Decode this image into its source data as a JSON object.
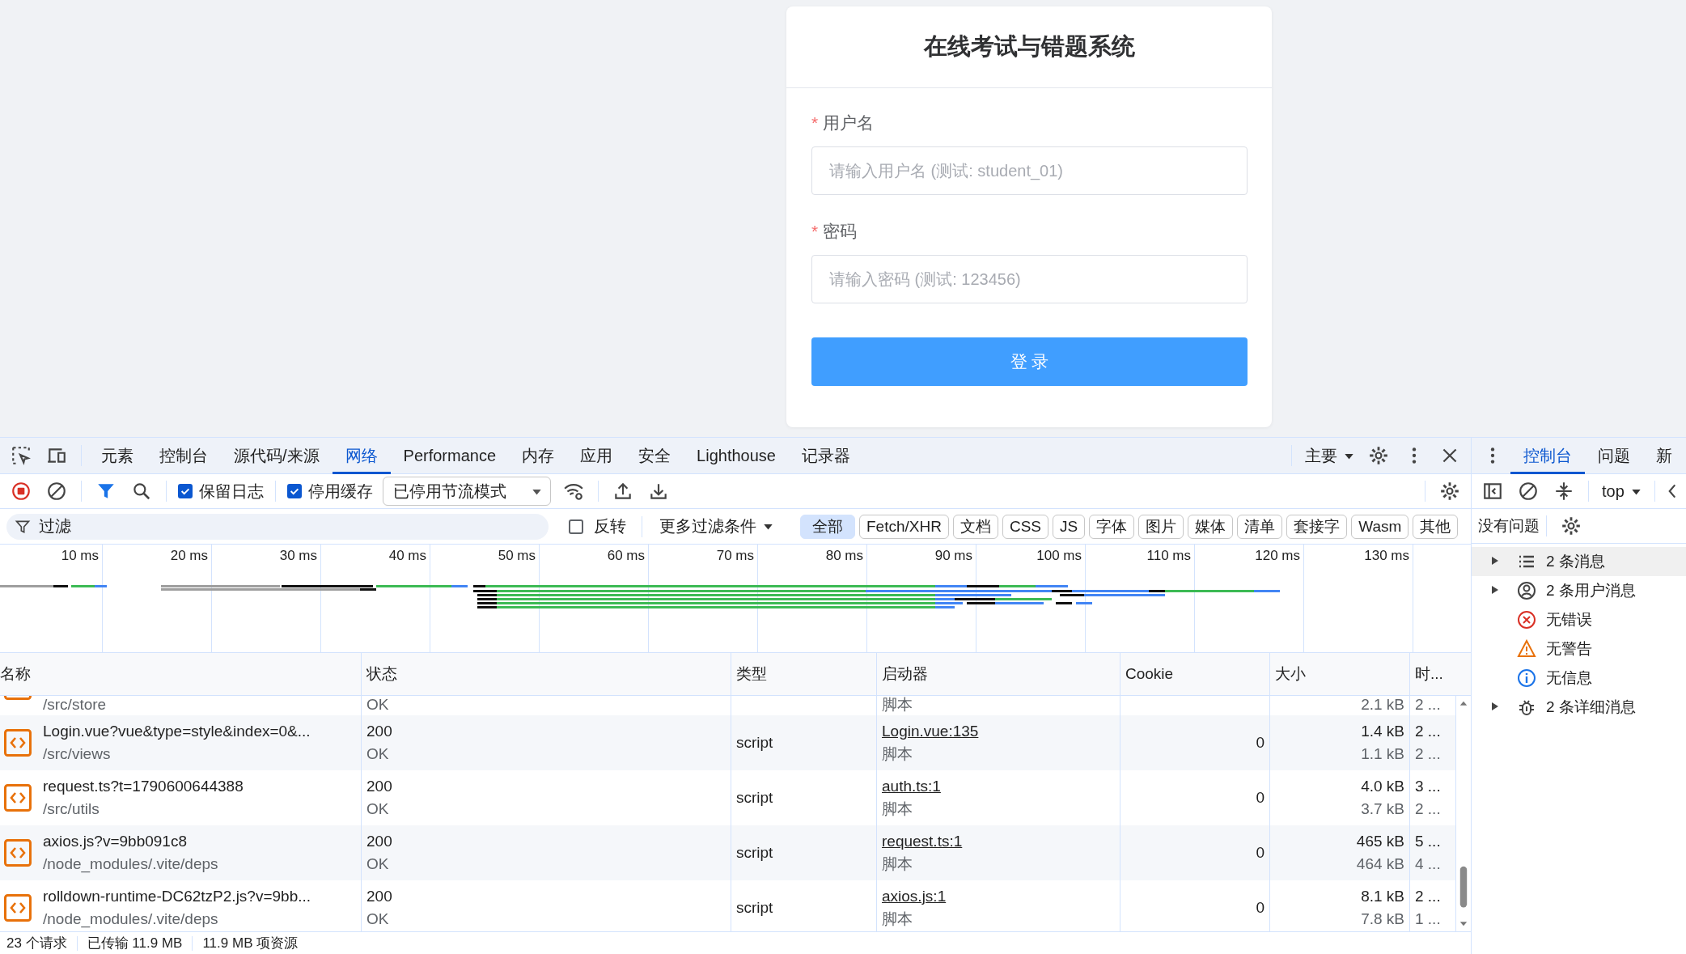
{
  "login": {
    "title": "在线考试与错题系统",
    "fields": [
      {
        "required_mark": "*",
        "label": "用户名",
        "placeholder": "请输入用户名 (测试: student_01)"
      },
      {
        "required_mark": "*",
        "label": "密码",
        "placeholder": "请输入密码 (测试: 123456)"
      }
    ],
    "button": "登 录"
  },
  "devtools": {
    "tabs": [
      {
        "label": "元素",
        "selected": false
      },
      {
        "label": "控制台",
        "selected": false
      },
      {
        "label": "源代码/来源",
        "selected": false
      },
      {
        "label": "网络",
        "selected": true
      },
      {
        "label": "Performance",
        "selected": false
      },
      {
        "label": "内存",
        "selected": false
      },
      {
        "label": "应用",
        "selected": false
      },
      {
        "label": "安全",
        "selected": false
      },
      {
        "label": "Lighthouse",
        "selected": false
      },
      {
        "label": "记录器",
        "selected": false
      }
    ],
    "panel_menu": "主要",
    "toolbar": {
      "recording": true,
      "filter_active": true,
      "checkboxes": [
        {
          "label": "保留日志",
          "checked": true
        },
        {
          "label": "停用缓存",
          "checked": true
        }
      ],
      "throttle": "已停用节流模式"
    },
    "filter": {
      "placeholder": "过滤",
      "invert": {
        "label": "反转",
        "checked": false
      },
      "more_filters": "更多过滤条件",
      "types": [
        {
          "label": "全部",
          "selected": true
        },
        {
          "label": "Fetch/XHR",
          "selected": false
        },
        {
          "label": "文档",
          "selected": false
        },
        {
          "label": "CSS",
          "selected": false
        },
        {
          "label": "JS",
          "selected": false
        },
        {
          "label": "字体",
          "selected": false
        },
        {
          "label": "图片",
          "selected": false
        },
        {
          "label": "媒体",
          "selected": false
        },
        {
          "label": "清单",
          "selected": false
        },
        {
          "label": "套接字",
          "selected": false
        },
        {
          "label": "Wasm",
          "selected": false
        },
        {
          "label": "其他",
          "selected": false
        }
      ]
    },
    "timeline": {
      "ticks": [
        "10 ms",
        "20 ms",
        "30 ms",
        "40 ms",
        "50 ms",
        "60 ms",
        "70 ms",
        "80 ms",
        "90 ms",
        "100 ms",
        "110 ms",
        "120 ms",
        "130 ms"
      ]
    },
    "table": {
      "columns": [
        "名称",
        "状态",
        "类型",
        "启动器",
        "Cookie",
        "大小",
        "时..."
      ],
      "rows": [
        {
          "path": "/src/store",
          "status_text": "OK",
          "initiator_type": "脚本",
          "resource_size": "2.1 kB",
          "time2": "2 ..."
        },
        {
          "name": "Login.vue?vue&type=style&index=0&...",
          "path": "/src/views",
          "status": "200",
          "status_text": "OK",
          "type": "script",
          "initiator": "Login.vue:135",
          "initiator_type": "脚本",
          "cookie": "0",
          "size": "1.4 kB",
          "resource_size": "1.1 kB",
          "time": "2 ...",
          "time2": "2 ..."
        },
        {
          "name": "request.ts?t=1790600644388",
          "path": "/src/utils",
          "status": "200",
          "status_text": "OK",
          "type": "script",
          "initiator": "auth.ts:1",
          "initiator_type": "脚本",
          "cookie": "0",
          "size": "4.0 kB",
          "resource_size": "3.7 kB",
          "time": "3 ...",
          "time2": "2 ..."
        },
        {
          "name": "axios.js?v=9bb091c8",
          "path": "/node_modules/.vite/deps",
          "status": "200",
          "status_text": "OK",
          "type": "script",
          "initiator": "request.ts:1",
          "initiator_type": "脚本",
          "cookie": "0",
          "size": "465 kB",
          "resource_size": "464 kB",
          "time": "5 ...",
          "time2": "4 ..."
        },
        {
          "name": "rolldown-runtime-DC62tzP2.js?v=9bb...",
          "path": "/node_modules/.vite/deps",
          "status": "200",
          "status_text": "OK",
          "type": "script",
          "initiator": "axios.js:1",
          "initiator_type": "脚本",
          "cookie": "0",
          "size": "8.1 kB",
          "resource_size": "7.8 kB",
          "time": "2 ...",
          "time2": "1 ..."
        }
      ]
    },
    "status_bar": [
      "23 个请求",
      "已传输 11.9 MB",
      "11.9 MB 项资源"
    ]
  },
  "console_drawer": {
    "tabs": [
      {
        "label": "控制台",
        "selected": true
      },
      {
        "label": "问题",
        "selected": false
      },
      {
        "label": "新",
        "selected": false
      }
    ],
    "context": "top",
    "issues": "没有问题",
    "messages": [
      {
        "kind": "all",
        "label": "2 条消息",
        "expandable": true,
        "selected": true
      },
      {
        "kind": "user",
        "label": "2 条用户消息",
        "expandable": true,
        "selected": false
      },
      {
        "kind": "error",
        "label": "无错误",
        "expandable": false,
        "selected": false
      },
      {
        "kind": "warning",
        "label": "无警告",
        "expandable": false,
        "selected": false
      },
      {
        "kind": "info",
        "label": "无信息",
        "expandable": false,
        "selected": false
      },
      {
        "kind": "verbose",
        "label": "2 条详细消息",
        "expandable": true,
        "selected": false
      }
    ]
  }
}
